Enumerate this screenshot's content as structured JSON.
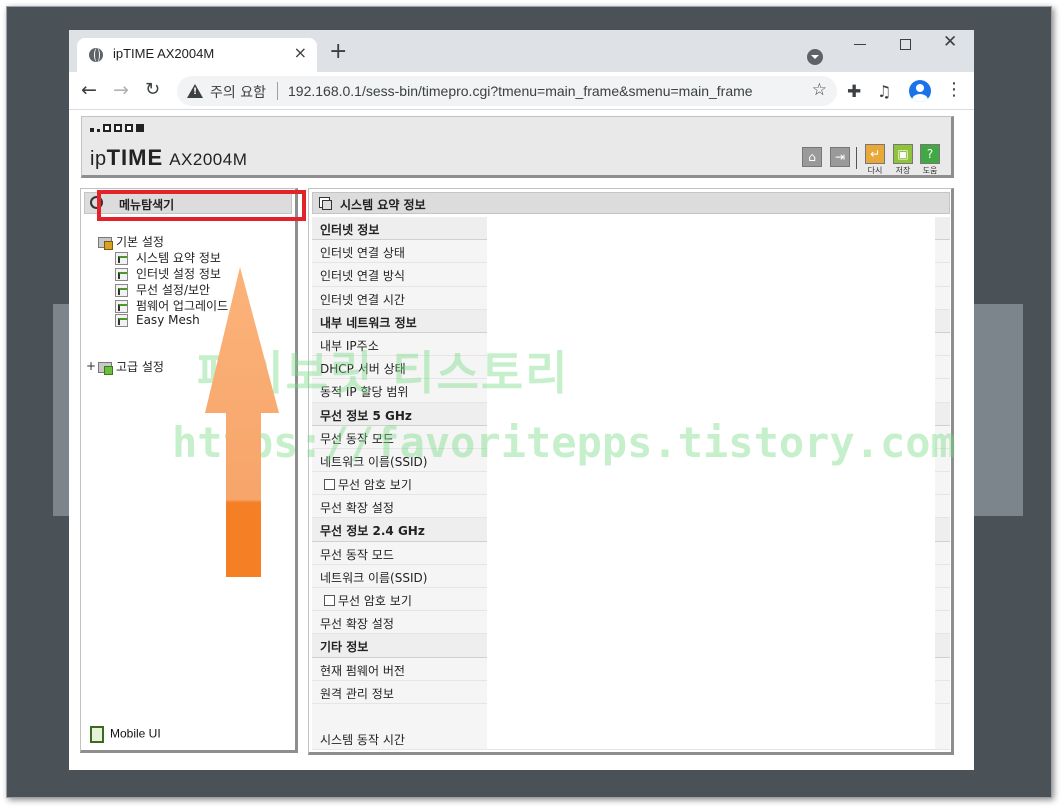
{
  "browser": {
    "tab_title": "ipTIME AX2004M",
    "tab_close": "×",
    "new_tab": "+",
    "security_label": "주의 요함",
    "url": "192.168.0.1/sess-bin/timepro.cgi?tmenu=main_frame&smenu=main_frame"
  },
  "header": {
    "brand_prefix": "ip",
    "brand_time": "TIME",
    "model": "AX2004M",
    "buttons": [
      {
        "label": "다시",
        "icon": "refresh-icon"
      },
      {
        "label": "저장",
        "icon": "save-icon"
      },
      {
        "label": "도움",
        "icon": "help-icon"
      }
    ]
  },
  "menu": {
    "title": "메뉴탐색기",
    "basic_group": "기본 설정",
    "basic_items": [
      "시스템 요약 정보",
      "인터넷 설정 정보",
      "무선 설정/보안",
      "펌웨어 업그레이드",
      "Easy Mesh"
    ],
    "advanced_group": "고급 설정",
    "mobile_ui": "Mobile UI"
  },
  "info": {
    "title": "시스템 요약 정보",
    "rows": [
      {
        "type": "section",
        "label": "인터넷 정보"
      },
      {
        "type": "field",
        "label": "인터넷 연결 상태"
      },
      {
        "type": "field",
        "label": "인터넷 연결 방식"
      },
      {
        "type": "field",
        "label": "인터넷 연결 시간"
      },
      {
        "type": "section",
        "label": "내부 네트워크 정보"
      },
      {
        "type": "field",
        "label": "내부 IP주소"
      },
      {
        "type": "field",
        "label": "DHCP 서버 상태"
      },
      {
        "type": "field",
        "label": "동적 IP 할당 범위"
      },
      {
        "type": "section",
        "label": "무선 정보 5 GHz"
      },
      {
        "type": "field",
        "label": "무선 동작 모드"
      },
      {
        "type": "field",
        "label": "네트워크 이름(SSID)"
      },
      {
        "type": "checkbox",
        "label": "무선 암호 보기"
      },
      {
        "type": "field",
        "label": "무선 확장 설정"
      },
      {
        "type": "section",
        "label": "무선 정보 2.4 GHz"
      },
      {
        "type": "field",
        "label": "무선 동작 모드"
      },
      {
        "type": "field",
        "label": "네트워크 이름(SSID)"
      },
      {
        "type": "checkbox",
        "label": "무선 암호 보기"
      },
      {
        "type": "field",
        "label": "무선 확장 설정"
      },
      {
        "type": "section",
        "label": "기타 정보"
      },
      {
        "type": "field",
        "label": "현재 펌웨어 버전"
      },
      {
        "type": "field",
        "label": "원격 관리 정보"
      },
      {
        "type": "tall",
        "label": "시스템 동작 시간"
      }
    ]
  },
  "watermark": {
    "line1": "페이보릿 티스토리",
    "line2": "https://favoritepps.tistory.com"
  },
  "colors": {
    "highlight_box": "#e3232c",
    "arrow": "#f7872a",
    "watermark": "#78dc82"
  }
}
